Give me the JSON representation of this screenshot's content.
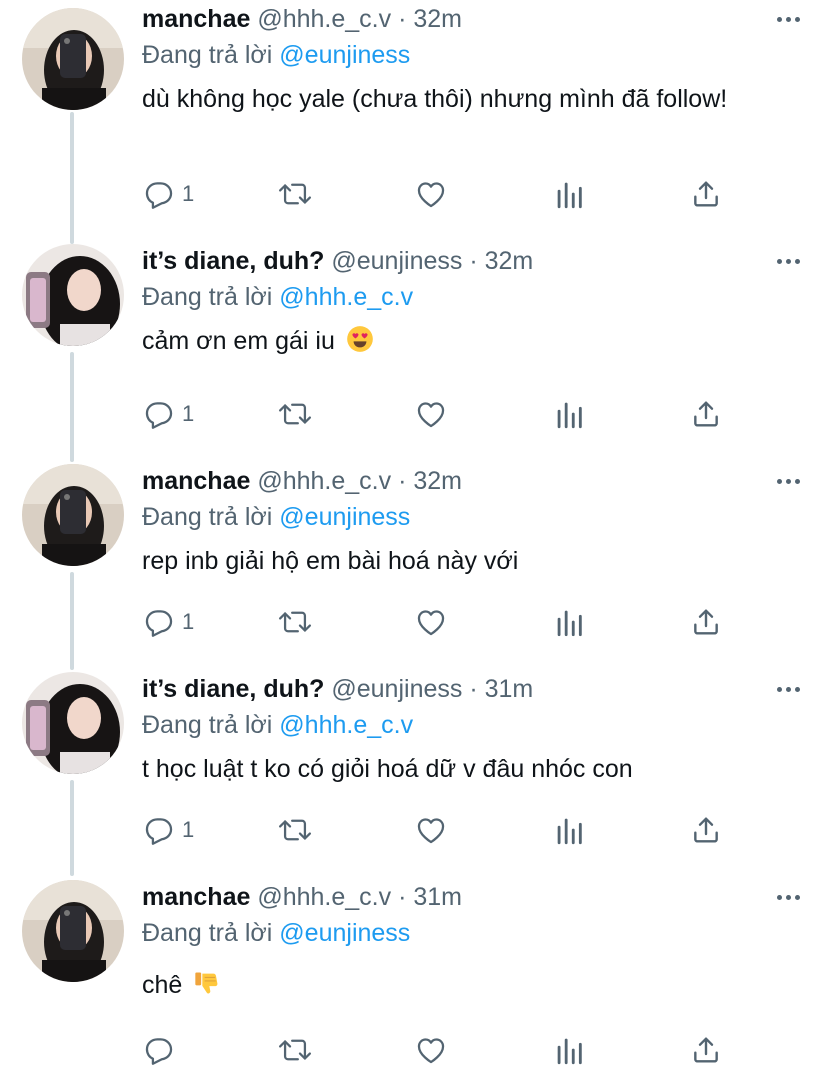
{
  "reply_prefix": "Đang trả lời",
  "tweets": [
    {
      "display_name": "manchae",
      "handle": "@hhh.e_c.v",
      "dot": "·",
      "time": "32m",
      "reply_to": "@eunjiness",
      "text": "dù không học yale (chưa thôi) nhưng mình đã follow!",
      "emoji": "",
      "reply_count": "1"
    },
    {
      "display_name": "it’s diane, duh?",
      "handle": "@eunjiness",
      "dot": "·",
      "time": "32m",
      "reply_to": "@hhh.e_c.v",
      "text": "cảm ơn em gái iu",
      "emoji": "heart-eyes",
      "reply_count": "1"
    },
    {
      "display_name": "manchae",
      "handle": "@hhh.e_c.v",
      "dot": "·",
      "time": "32m",
      "reply_to": "@eunjiness",
      "text": "rep inb giải hộ em bài hoá này với",
      "emoji": "",
      "reply_count": "1"
    },
    {
      "display_name": "it’s diane, duh?",
      "handle": "@eunjiness",
      "dot": "·",
      "time": "31m",
      "reply_to": "@hhh.e_c.v",
      "text": "t học luật t ko có giỏi hoá dữ v đâu nhóc con",
      "emoji": "",
      "reply_count": "1"
    },
    {
      "display_name": "manchae",
      "handle": "@hhh.e_c.v",
      "dot": "·",
      "time": "31m",
      "reply_to": "@eunjiness",
      "text": "chê",
      "emoji": "thumbs-down",
      "reply_count": ""
    }
  ],
  "icons": {
    "reply": "reply-icon",
    "retweet": "retweet-icon",
    "like": "heart-icon",
    "analytics": "analytics-icon",
    "share": "share-icon",
    "more": "more-icon"
  },
  "colors": {
    "text": "#0f1419",
    "secondary": "#536471",
    "mention": "#1d9bf0",
    "thread_line": "#cfd9de"
  }
}
